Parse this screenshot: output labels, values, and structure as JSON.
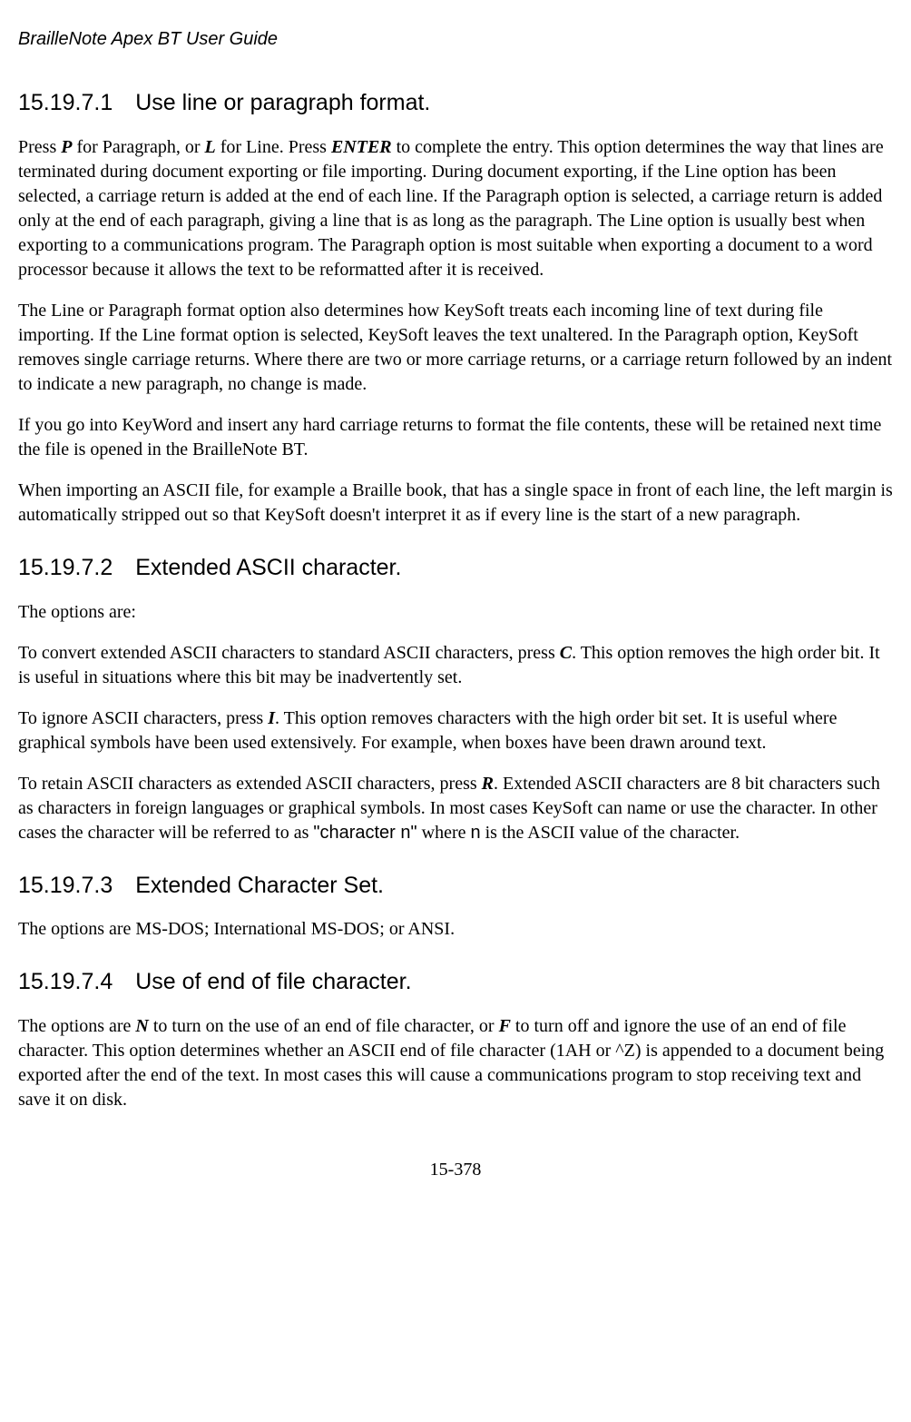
{
  "header": "BrailleNote Apex BT User Guide",
  "footer": "15-378",
  "s1": {
    "num": "15.19.7.1",
    "title": "Use line or paragraph format.",
    "p1a": "Press ",
    "p1k1": "P",
    "p1b": " for Paragraph, or ",
    "p1k2": "L",
    "p1c": " for Line. Press ",
    "p1k3": "ENTER",
    "p1d": " to complete the entry. This option determines the way that lines are terminated during document exporting or file importing. During document exporting, if the Line option has been selected, a carriage return is added at the end of each line. If the Paragraph option is selected, a carriage return is added only at the end of each paragraph, giving a line that is as long as the paragraph. The Line option is usually best when exporting to a communications program. The Paragraph option is most suitable when exporting a document to a word processor because it allows the text to be reformatted after it is received.",
    "p2": "The Line or Paragraph format option also determines how KeySoft treats each incoming line of text during file importing. If the Line format option is selected, KeySoft leaves the text unaltered. In the Paragraph option, KeySoft removes single carriage returns. Where there are two or more carriage returns, or a carriage return followed by an indent to indicate a new paragraph, no change is made.",
    "p3": "If you go into KeyWord and insert any hard carriage returns to format the file contents, these will be retained next time the file is opened in the BrailleNote BT.",
    "p4": "When importing an ASCII file, for example a Braille book, that has a single space in front of each line, the left margin is automatically stripped out so that KeySoft doesn't interpret it as if every line is the start of a new paragraph."
  },
  "s2": {
    "num": "15.19.7.2",
    "title": "Extended ASCII character.",
    "p1": "The options are:",
    "p2a": "To convert extended ASCII characters to standard ASCII characters, press ",
    "p2k": "C",
    "p2b": ". This option removes the high order bit. It is useful in situations where this bit may be inadvertently set.",
    "p3a": "To ignore ASCII characters, press ",
    "p3k": "I",
    "p3b": ". This option removes characters with the high order bit set. It is useful where graphical symbols have been used extensively. For example, when boxes have been drawn around text.",
    "p4a": "To retain ASCII characters as extended ASCII characters, press ",
    "p4k": "R",
    "p4b": ". Extended ASCII characters are 8 bit characters such as characters in foreign languages or graphical symbols. In most cases KeySoft can name or use the character. In other cases the character will be referred to as ",
    "p4s1": "\"character n\"",
    "p4c": " where ",
    "p4s2": "n",
    "p4d": " is the ASCII value of the character."
  },
  "s3": {
    "num": "15.19.7.3",
    "title": "Extended Character Set.",
    "p1": "The options are MS-DOS; International MS-DOS; or ANSI."
  },
  "s4": {
    "num": "15.19.7.4",
    "title": "Use of end of file character.",
    "p1a": "The options are ",
    "p1k1": "N",
    "p1b": " to turn on the use of an end of file character, or ",
    "p1k2": "F",
    "p1c": " to turn off and ignore the use of an end of file character. This option determines whether an ASCII end of file character (1AH or ^Z) is appended to a document being exported after the end of the text. In most cases this will cause a communications program to stop receiving text and save it on disk."
  }
}
